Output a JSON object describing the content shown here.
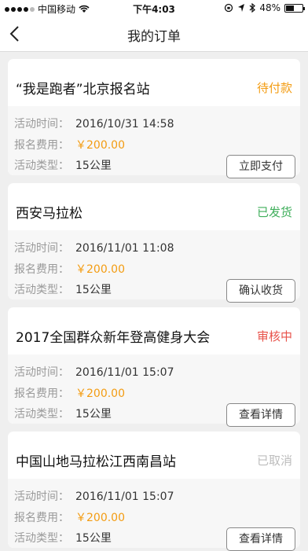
{
  "status_bar": {
    "carrier": "中国移动",
    "time": "下午4:03",
    "battery": "48%",
    "battery_level": 0.48
  },
  "nav": {
    "title": "我的订单"
  },
  "labels": {
    "time": "活动时间：",
    "fee": "报名费用：",
    "type": "活动类型："
  },
  "orders": [
    {
      "title": "“我是跑者”北京报名站",
      "status": "待付款",
      "status_color": "#f39c12",
      "time": "2016/10/31  14:58",
      "fee": "￥200.00",
      "type": "15公里",
      "action": "立即支付"
    },
    {
      "title": "西安马拉松",
      "status": "已发货",
      "status_color": "#3fae5b",
      "time": "2016/11/01  11:08",
      "fee": "￥200.00",
      "type": "15公里",
      "action": "确认收货"
    },
    {
      "title": "2017全国群众新年登高健身大会",
      "status": "审核中",
      "status_color": "#e8524a",
      "time": "2016/11/01  15:07",
      "fee": "￥200.00",
      "type": "15公里",
      "action": "查看详情"
    },
    {
      "title": "中国山地马拉松江西南昌站",
      "status": "已取消",
      "status_color": "#bdbdbd",
      "time": "2016/11/01  15:07",
      "fee": "￥200.00",
      "type": "15公里",
      "action": "查看详情"
    }
  ]
}
